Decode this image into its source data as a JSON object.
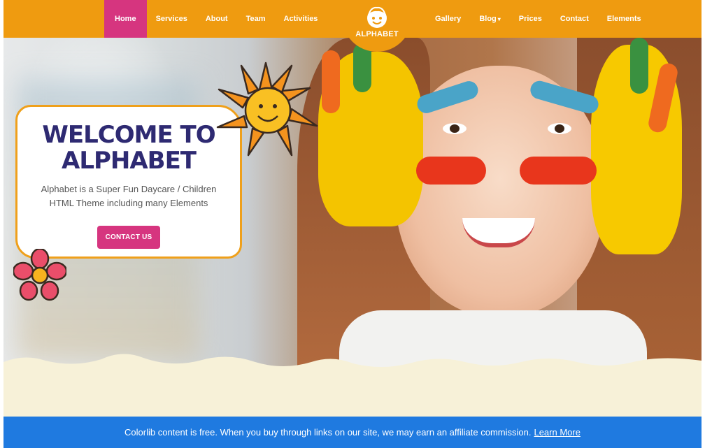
{
  "nav": {
    "left": [
      "Home",
      "Services",
      "About",
      "Team",
      "Activities"
    ],
    "right": [
      "Gallery",
      "Blog",
      "Prices",
      "Contact",
      "Elements"
    ],
    "blog_caret": "▾"
  },
  "logo": {
    "text": "ALPHABET",
    "icon": "kid-face-icon"
  },
  "hero": {
    "title_line1": "WELCOME TO",
    "title_line2": "ALPHABET",
    "description_line1": "Alphabet is a Super Fun Daycare / Children",
    "description_line2": "HTML Theme including many Elements",
    "cta_label": "CONTACT US",
    "slider_prev": "›",
    "slider_pause": "❚❚"
  },
  "affiliate": {
    "text": "Colorlib content is free. When you buy through links on our site, we may earn an affiliate commission.",
    "link": "Learn More"
  },
  "colors": {
    "header": "#ef9b10",
    "active_nav": "#d6357f",
    "button": "#d6357f",
    "title": "#2e2a72",
    "banner": "#1f7ae0",
    "cream": "#f7f1d8"
  }
}
